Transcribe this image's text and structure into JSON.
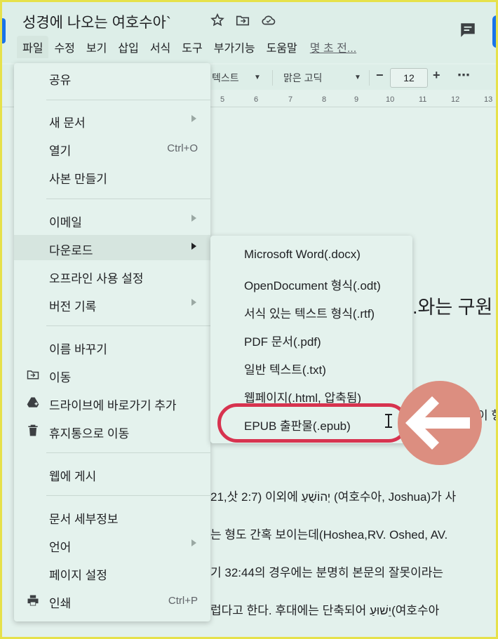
{
  "title": "성경에 나오는 여호수아`",
  "menubar": [
    "파일",
    "수정",
    "보기",
    "삽입",
    "서식",
    "도구",
    "부가기능",
    "도움말"
  ],
  "last_edit": "몇 초 전...",
  "toolbar": {
    "style": "텍스트",
    "font": "맑은 고딕",
    "font_size": "12",
    "minus": "−",
    "plus": "+",
    "more": "⋯"
  },
  "ruler_numbers": [
    "5",
    "6",
    "7",
    "8",
    "9",
    "10",
    "11",
    "12",
    "13"
  ],
  "file_menu": {
    "share": "공유",
    "new_doc": "새 문서",
    "open": "열기",
    "open_shortcut": "Ctrl+O",
    "make_copy": "사본 만들기",
    "email": "이메일",
    "download": "다운로드",
    "offline": "오프라인 사용 설정",
    "version_history": "버전 기록",
    "rename": "이름 바꾸기",
    "move": "이동",
    "add_shortcut": "드라이브에 바로가기 추가",
    "trash": "휴지통으로 이동",
    "publish": "웹에 게시",
    "details": "문서 세부정보",
    "language": "언어",
    "page_setup": "페이지 설정",
    "print": "인쇄",
    "print_shortcut": "Ctrl+P"
  },
  "download_menu": [
    "Microsoft Word(.docx)",
    "OpenDocument 형식(.odt)",
    "서식 있는 텍스트 형식(.rtf)",
    "PDF 문서(.pdf)",
    "일반 텍스트(.txt)",
    "웹페이지(.html, 압축됨)",
    "EPUB 출판물(.epub)"
  ],
  "doc_fragments": {
    "heading_tail": ".와는 구원",
    "line_a": "이 형",
    "line1": "21,삿 2:7) 이외에 יְהוֹשֻׁעַ (여호수아, Joshua)가 사",
    "line2": "는 형도 간혹 보이는데(Hoshea,RV. Oshed, AV.",
    "line3": "기 32:44의 경우에는 분명히 본문의 잘못이라는",
    "line4": "럽다고 한다. 후대에는 단축되어 יֵשׁוּעַ(여호수아"
  },
  "colors": {
    "highlight_ring": "#d7334f",
    "arrow_circle": "#dc8e80",
    "accent": "#1a73e8"
  },
  "icons": [
    "star-icon",
    "move-folder-icon",
    "cloud-status-icon",
    "comment-icon",
    "folder-move-icon",
    "drive-shortcut-icon",
    "trash-icon",
    "print-icon",
    "text-cursor-icon",
    "left-arrow-icon"
  ]
}
